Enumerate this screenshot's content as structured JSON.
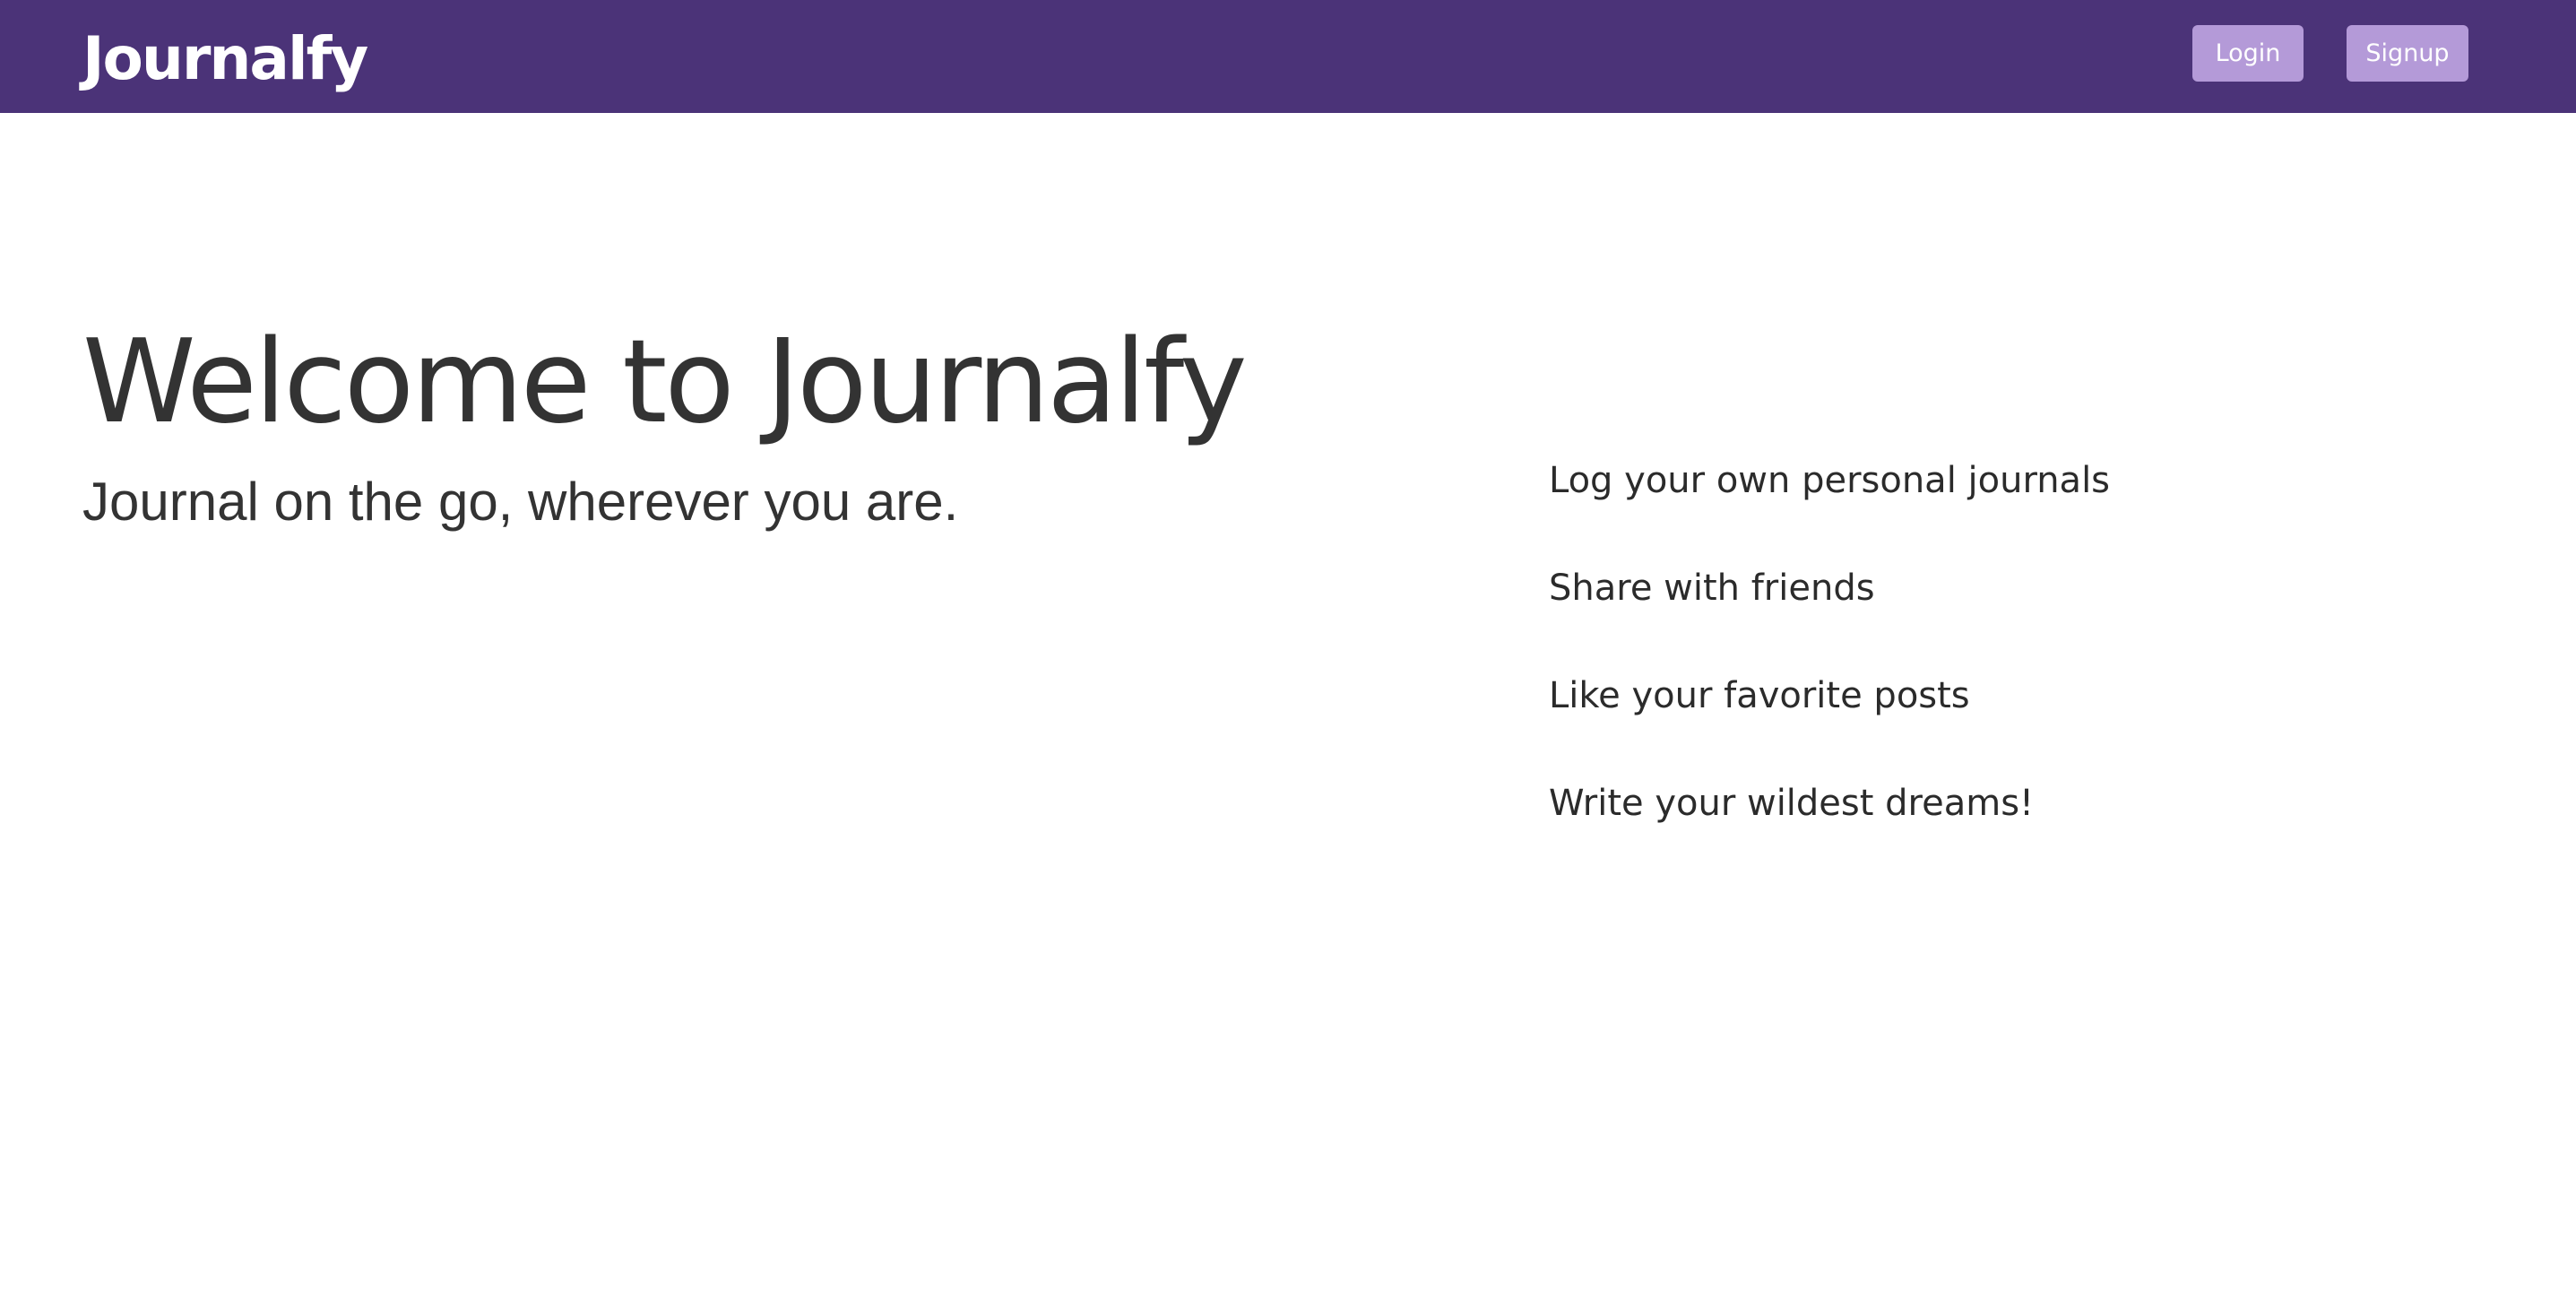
{
  "header": {
    "brand": "Journalfy",
    "login_label": "Login",
    "signup_label": "Signup"
  },
  "hero": {
    "title": "Welcome to Journalfy",
    "subtitle": "Journal on the go, wherever you are."
  },
  "features": [
    "Log your own personal journals",
    "Share with friends",
    "Like your favorite posts",
    "Write your wildest dreams!"
  ],
  "colors": {
    "navbar": "#4b3378",
    "button": "#b49ad8",
    "text": "#333333"
  }
}
